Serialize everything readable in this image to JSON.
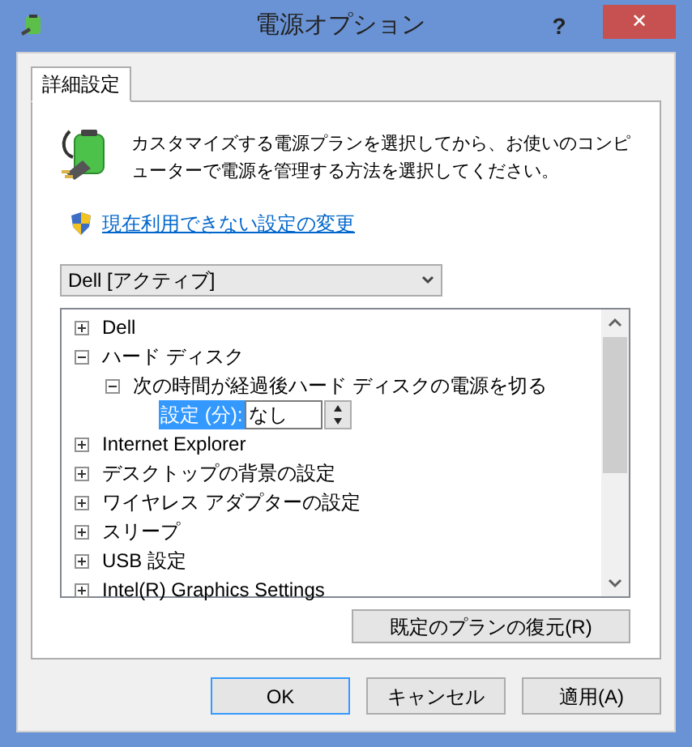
{
  "window": {
    "title": "電源オプション",
    "help": "?",
    "close": "✕"
  },
  "tabs": [
    {
      "label": "詳細設定",
      "selected": true
    }
  ],
  "description": "カスタマイズする電源プランを選択してから、お使いのコンピューターで電源を管理する方法を選択してください。",
  "link": "現在利用できない設定の変更",
  "plan_dropdown": {
    "value": "Dell [アクティブ]"
  },
  "tree": [
    {
      "kind": "group",
      "label": "Dell",
      "expanded": false
    },
    {
      "kind": "group",
      "label": "ハード ディスク",
      "expanded": true,
      "children": [
        {
          "kind": "group",
          "label": "次の時間が経過後ハード ディスクの電源を切る",
          "expanded": true,
          "children": [
            {
              "kind": "setting",
              "label": "設定 (分):",
              "value": "なし",
              "selected": true
            }
          ]
        }
      ]
    },
    {
      "kind": "group",
      "label": "Internet Explorer",
      "expanded": false
    },
    {
      "kind": "group",
      "label": "デスクトップの背景の設定",
      "expanded": false
    },
    {
      "kind": "group",
      "label": "ワイヤレス アダプターの設定",
      "expanded": false
    },
    {
      "kind": "group",
      "label": "スリープ",
      "expanded": false
    },
    {
      "kind": "group",
      "label": "USB 設定",
      "expanded": false
    },
    {
      "kind": "group",
      "label": "Intel(R) Graphics Settings",
      "expanded": false
    }
  ],
  "restore_button": "既定のプランの復元(R)",
  "buttons": [
    {
      "label": "OK",
      "selected": true
    },
    {
      "label": "キャンセル",
      "selected": false
    },
    {
      "label": "適用(A)",
      "selected": false
    }
  ]
}
